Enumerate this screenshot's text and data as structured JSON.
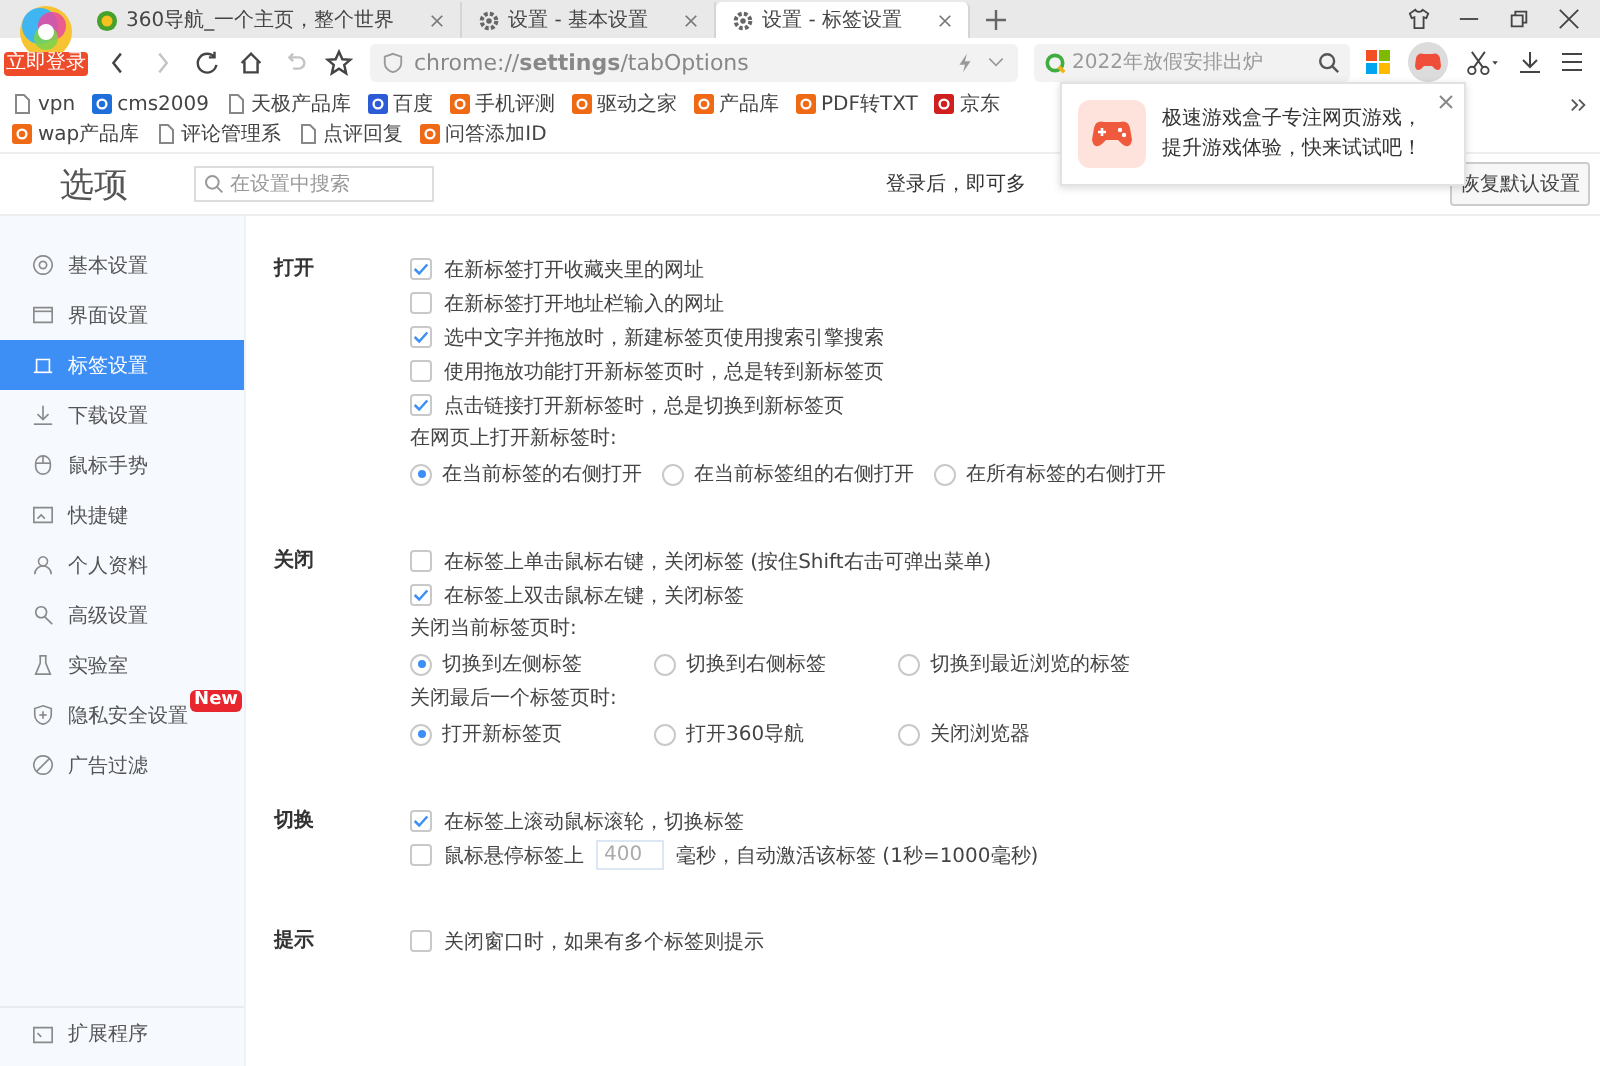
{
  "logo": {
    "badge": "立即登录"
  },
  "tabs": [
    {
      "title": "360导航_一个主页，整个世界",
      "selected": false
    },
    {
      "title": "设置 - 基本设置",
      "selected": false
    },
    {
      "title": "设置 - 标签设置",
      "selected": true
    }
  ],
  "toolbar": {
    "nav_buttons": [
      {
        "disabled": false
      },
      {
        "disabled": true
      },
      {
        "disabled": false
      },
      {
        "disabled": false
      },
      {
        "disabled": true
      },
      {
        "disabled": false
      }
    ],
    "address": "chrome://**settings**/tabOptions",
    "search_placeholder": "2022年放假安排出炉"
  },
  "bookmarks": [
    "vpn",
    "cms2009",
    "天极产品库",
    "百度",
    "手机评测",
    "驱动之家",
    "产品库",
    "PDF转TXT",
    "京东",
    "wap产品库",
    "评论管理系",
    "点评回复",
    "问答添加ID"
  ],
  "popup": {
    "text": "极速游戏盒子专注网页游戏，提升游戏体验，快来试试吧！"
  },
  "header": {
    "title": "选项",
    "search_placeholder": "在设置中搜索",
    "login_hint": "登录后，即可多",
    "reset_button": "恢复默认设置"
  },
  "sidebar": {
    "items": [
      {
        "label": "基本设置",
        "selected": false
      },
      {
        "label": "界面设置",
        "selected": false
      },
      {
        "label": "标签设置",
        "selected": true
      },
      {
        "label": "下载设置",
        "selected": false
      },
      {
        "label": "鼠标手势",
        "selected": false
      },
      {
        "label": "快捷键",
        "selected": false
      },
      {
        "label": "个人资料",
        "selected": false
      },
      {
        "label": "高级设置",
        "selected": false
      },
      {
        "label": "实验室",
        "selected": false
      },
      {
        "label": "隐私安全设置",
        "selected": false,
        "badge": "New"
      },
      {
        "label": "广告过滤",
        "selected": false
      }
    ],
    "footer": "扩展程序"
  },
  "sections": [
    {
      "title": "打开",
      "items": [
        {
          "kind": "checkbox",
          "label": "在新标签打开收藏夹里的网址",
          "checked": true
        },
        {
          "kind": "checkbox",
          "label": "在新标签打开地址栏输入的网址",
          "checked": false
        },
        {
          "kind": "checkbox",
          "label": "选中文字并拖放时，新建标签页使用搜索引擎搜索",
          "checked": true
        },
        {
          "kind": "checkbox",
          "label": "使用拖放功能打开新标签页时，总是转到新标签页",
          "checked": false
        },
        {
          "kind": "checkbox",
          "label": "点击链接打开新标签时，总是切换到新标签页",
          "checked": true
        },
        {
          "kind": "caption",
          "label": "在网页上打开新标签时:"
        },
        {
          "kind": "radios",
          "options": [
            {
              "label": "在当前标签的右侧打开",
              "selected": true
            },
            {
              "label": "在当前标签组的右侧打开",
              "selected": false
            },
            {
              "label": "在所有标签的右侧打开",
              "selected": false
            }
          ]
        }
      ]
    },
    {
      "title": "关闭",
      "items": [
        {
          "kind": "checkbox",
          "label": "在标签上单击鼠标右键，关闭标签 (按住Shift右击可弹出菜单)",
          "checked": false
        },
        {
          "kind": "checkbox",
          "label": "在标签上双击鼠标左键，关闭标签",
          "checked": true
        },
        {
          "kind": "caption",
          "label": "关闭当前标签页时:"
        },
        {
          "kind": "radios",
          "options": [
            {
              "label": "切换到左侧标签",
              "selected": true
            },
            {
              "label": "切换到右侧标签",
              "selected": false
            },
            {
              "label": "切换到最近浏览的标签",
              "selected": false
            }
          ]
        },
        {
          "kind": "caption",
          "label": "关闭最后一个标签页时:"
        },
        {
          "kind": "radios",
          "options": [
            {
              "label": "打开新标签页",
              "selected": true
            },
            {
              "label": "打开360导航",
              "selected": false
            },
            {
              "label": "关闭浏览器",
              "selected": false
            }
          ]
        }
      ]
    },
    {
      "title": "切换",
      "items": [
        {
          "kind": "checkbox",
          "label": "在标签上滚动鼠标滚轮，切换标签",
          "checked": true
        },
        {
          "kind": "delay",
          "checked": false,
          "label_before": "鼠标悬停标签上",
          "value": "400",
          "label_after": "毫秒，自动激活该标签 (1秒=1000毫秒)"
        }
      ]
    },
    {
      "title": "提示",
      "items": [
        {
          "kind": "checkbox",
          "label": "关闭窗口时，如果有多个标签则提示",
          "checked": false
        }
      ]
    }
  ]
}
